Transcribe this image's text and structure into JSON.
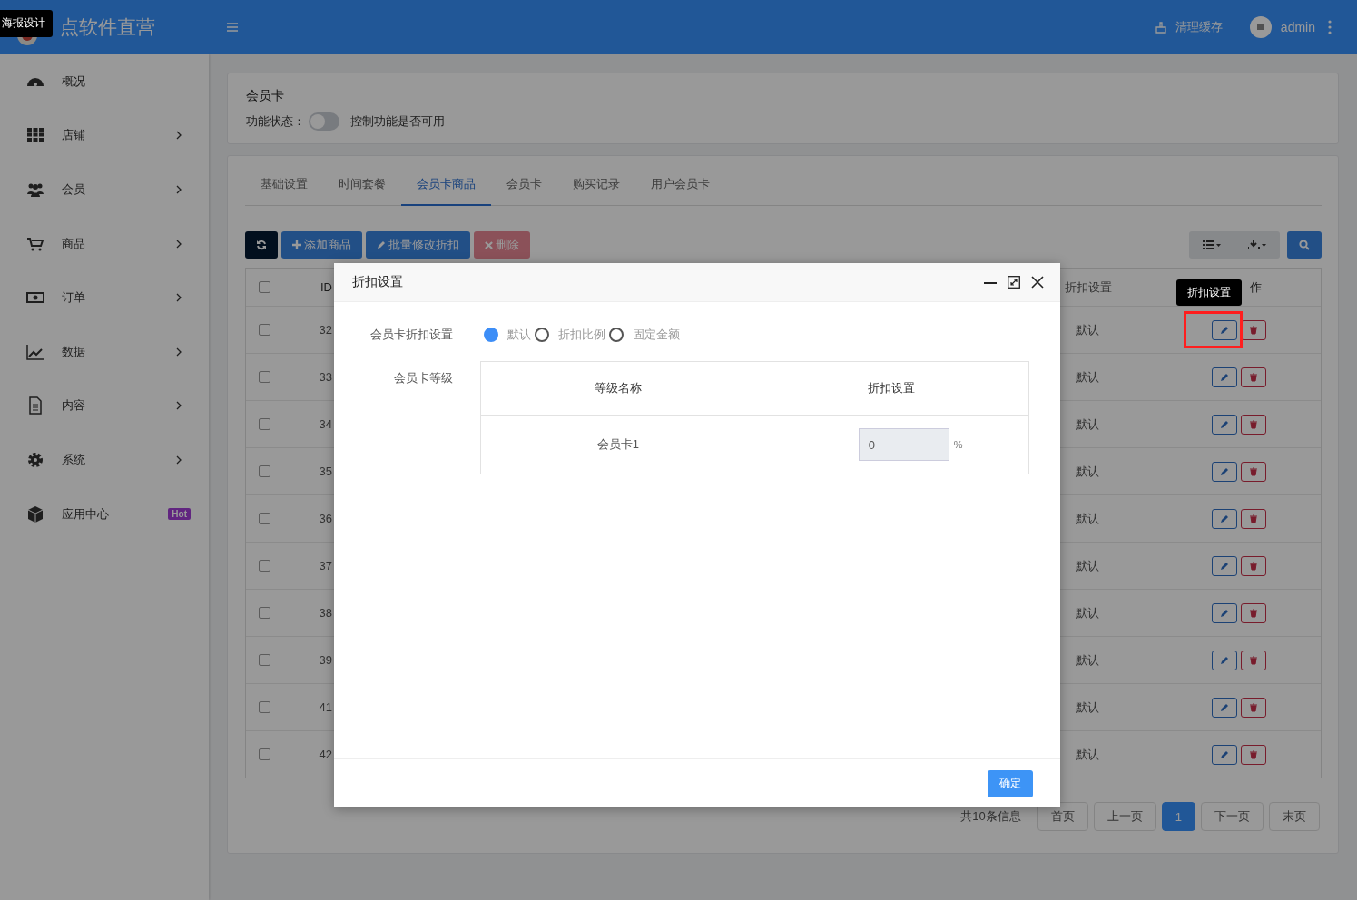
{
  "header": {
    "brand_tooltip": "海报设计",
    "brand": "点软件直营",
    "clear_cache": "清理缓存",
    "user": "admin"
  },
  "sidebar": {
    "items": [
      {
        "label": "概况",
        "has_submenu": false
      },
      {
        "label": "店铺",
        "has_submenu": true
      },
      {
        "label": "会员",
        "has_submenu": true
      },
      {
        "label": "商品",
        "has_submenu": true
      },
      {
        "label": "订单",
        "has_submenu": true
      },
      {
        "label": "数据",
        "has_submenu": true
      },
      {
        "label": "内容",
        "has_submenu": true
      },
      {
        "label": "系统",
        "has_submenu": true
      },
      {
        "label": "应用中心",
        "has_submenu": false,
        "badge": "Hot"
      }
    ]
  },
  "plugin": {
    "title": "会员卡",
    "status_label": "功能状态：",
    "enabled": false,
    "hint": "控制功能是否可用"
  },
  "tabs": [
    {
      "label": "基础设置",
      "selected": false
    },
    {
      "label": "时间套餐",
      "selected": false
    },
    {
      "label": "会员卡商品",
      "selected": true
    },
    {
      "label": "会员卡",
      "selected": false
    },
    {
      "label": "购买记录",
      "selected": false
    },
    {
      "label": "用户会员卡",
      "selected": false
    }
  ],
  "toolbar": {
    "buttons": [
      {
        "kind": "refresh",
        "disabled": false
      },
      {
        "kind": "add",
        "label": "添加商品",
        "disabled": false
      },
      {
        "kind": "edit",
        "label": "批量修改折扣",
        "disabled": false
      },
      {
        "kind": "delete",
        "label": "删除",
        "disabled": true
      }
    ]
  },
  "table": {
    "all_selected": false,
    "columns": [
      "ID",
      "折扣设置",
      "作"
    ],
    "rows": [
      {
        "id": "32",
        "discount": "默认",
        "selected": false
      },
      {
        "id": "33",
        "discount": "默认",
        "selected": false
      },
      {
        "id": "34",
        "discount": "默认",
        "selected": false
      },
      {
        "id": "35",
        "discount": "默认",
        "selected": false
      },
      {
        "id": "36",
        "discount": "默认",
        "selected": false
      },
      {
        "id": "37",
        "discount": "默认",
        "selected": false
      },
      {
        "id": "38",
        "discount": "默认",
        "selected": false
      },
      {
        "id": "39",
        "discount": "默认",
        "selected": false
      },
      {
        "id": "41",
        "discount": "默认",
        "selected": false
      },
      {
        "id": "42",
        "discount": "默认",
        "selected": false
      }
    ],
    "action_tooltip": "折扣设置"
  },
  "pagination": {
    "summary": "共10条信息",
    "pages": [
      {
        "label": "首页",
        "selected": false
      },
      {
        "label": "上一页",
        "selected": false
      },
      {
        "label": "1",
        "selected": true
      },
      {
        "label": "下一页",
        "selected": false
      },
      {
        "label": "末页",
        "selected": false
      }
    ]
  },
  "modal": {
    "title": "折扣设置",
    "mode_label": "会员卡折扣设置",
    "modes": [
      {
        "label": "默认",
        "selected": true
      },
      {
        "label": "折扣比例",
        "selected": false
      },
      {
        "label": "固定金额",
        "selected": false
      }
    ],
    "level_label": "会员卡等级",
    "level_columns": [
      "等级名称",
      "折扣设置"
    ],
    "level_rows": [
      {
        "name": "会员卡1",
        "value": "0",
        "unit": "%"
      }
    ],
    "confirm": "确定"
  }
}
